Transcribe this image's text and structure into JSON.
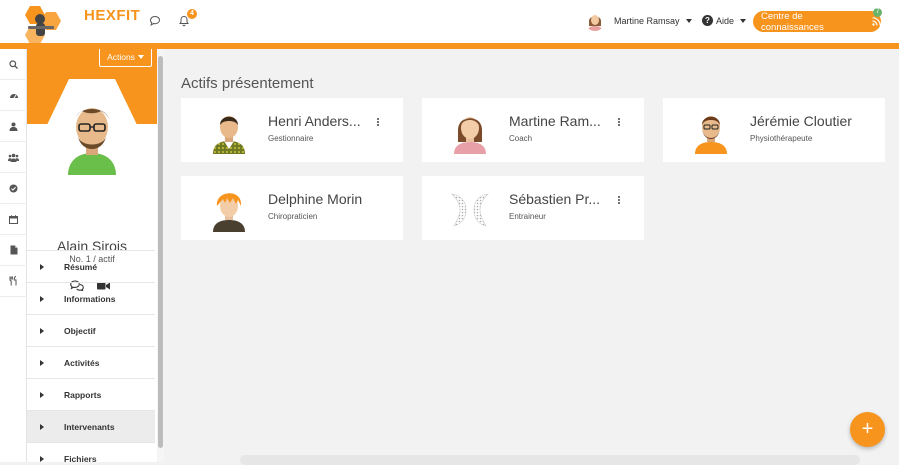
{
  "header": {
    "logo_text": "HEXFIT",
    "notifications_count": "4",
    "user_name": "Martine Ramsay",
    "help_label": "Aide",
    "knowledge_base_label": "Centre de connaissances",
    "knowledge_badge": "7",
    "accent_color": "#f7941d"
  },
  "rail": {
    "icons": [
      "search-icon",
      "dashboard-icon",
      "user-icon",
      "group-icon",
      "check-circle-icon",
      "calendar-icon",
      "document-icon",
      "nutrition-icon"
    ]
  },
  "profile": {
    "actions_label": "Actions",
    "name": "Alain Sirois",
    "subtitle": "No. 1 / actif"
  },
  "menu": {
    "items": [
      {
        "label": "Résumé"
      },
      {
        "label": "Informations"
      },
      {
        "label": "Objectif"
      },
      {
        "label": "Activités"
      },
      {
        "label": "Rapports"
      },
      {
        "label": "Intervenants"
      },
      {
        "label": "Fichiers"
      }
    ],
    "active_index": 5
  },
  "main": {
    "section_title": "Actifs présentement",
    "cards": [
      {
        "name": "Henri Anders...",
        "role": "Gestionnaire"
      },
      {
        "name": "Martine Ram...",
        "role": "Coach"
      },
      {
        "name": "Jérémie Cloutier",
        "role": "Physiothérapeute"
      },
      {
        "name": "Delphine Morin",
        "role": "Chiropraticien"
      },
      {
        "name": "Sébastien Pr...",
        "role": "Entraineur"
      }
    ],
    "fab_label": "+"
  }
}
